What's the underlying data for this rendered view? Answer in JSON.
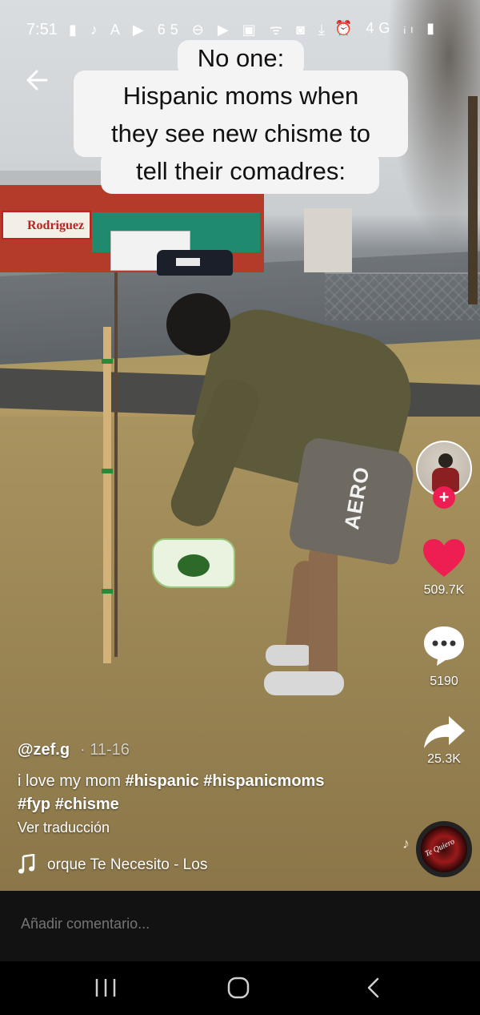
{
  "status_bar": {
    "time": "7:51",
    "left_icons": "▮ ♪ A ▶ 65 ⊖ ▶ ▣ ᯤ ◙ ⤓",
    "right_icons": "⏰ 4G ᵢₗ ▮"
  },
  "overlay_caption": {
    "line1": "No one:",
    "line2": "Hispanic moms when",
    "line3": "they see new chisme to",
    "line4": "tell their comadres:"
  },
  "scene_text": {
    "store_sign": "Rodriguez",
    "shorts_print": "AERO"
  },
  "actions": {
    "likes": "509.7K",
    "comments": "5190",
    "shares": "25.3K",
    "like_color": "#ee1d52",
    "follow_color": "#ee1d52"
  },
  "post": {
    "username": "@zef.g",
    "date": "· 11-16",
    "description_text": "i love my mom ",
    "hashtags": [
      "#hispanic",
      "#hispanicmoms",
      "#fyp",
      "#chisme"
    ],
    "translate_label": "Ver traducción",
    "music": "orque Te Necesito - Los",
    "disc_label": "Te Quiero"
  },
  "comment_bar": {
    "placeholder": "Añadir comentario..."
  },
  "icons": {
    "back": "back-arrow-icon",
    "like": "heart-icon",
    "comment": "comment-bubble-icon",
    "share": "share-arrow-icon",
    "music": "music-note-icon",
    "nav_recents": "recents-icon",
    "nav_home": "home-icon",
    "nav_back": "nav-back-icon"
  }
}
